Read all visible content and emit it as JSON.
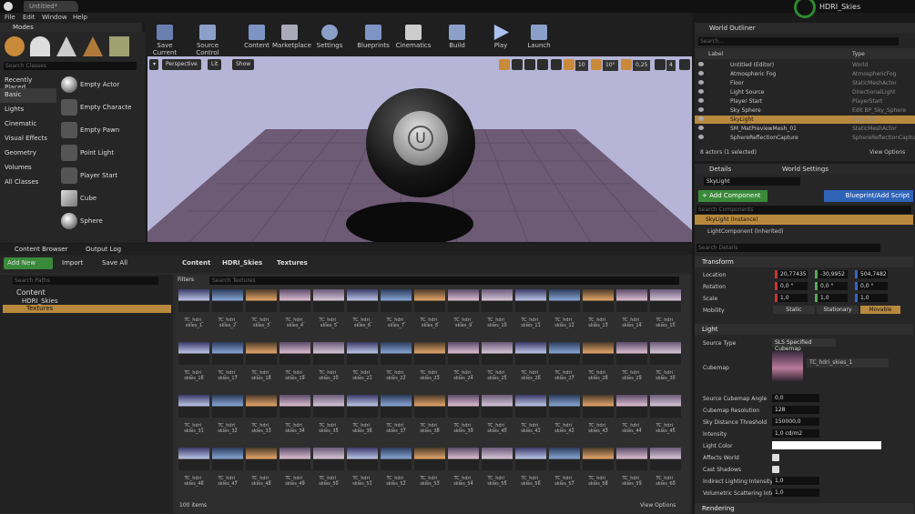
{
  "window": {
    "tab": "Untitled*",
    "project": "HDRI_Skies"
  },
  "menu": [
    "File",
    "Edit",
    "Window",
    "Help"
  ],
  "modes": {
    "tab": "Modes",
    "search_placeholder": "Search Classes",
    "categories": [
      "Recently Placed",
      "Basic",
      "Lights",
      "Cinematic",
      "Visual Effects",
      "Geometry",
      "Volumes",
      "All Classes"
    ],
    "actors": [
      "Empty Actor",
      "Empty Characte",
      "Empty Pawn",
      "Point Light",
      "Player Start",
      "Cube",
      "Sphere"
    ]
  },
  "toolbar": [
    "Save Current",
    "Source Control",
    "Content",
    "Marketplace",
    "Settings",
    "Blueprints",
    "Cinematics",
    "Build",
    "Play",
    "Launch"
  ],
  "viewport": {
    "perspective": "Perspective",
    "lit": "Lit",
    "show": "Show",
    "snap": "10",
    "rot": "10°",
    "scale": "0,25",
    "cams": "4"
  },
  "outliner": {
    "tab": "World Outliner",
    "search": "Search...",
    "col_label": "Label",
    "col_type": "Type",
    "rows": [
      [
        "Untitled (Editor)",
        "World"
      ],
      [
        "Atmospheric Fog",
        "AtmosphericFog"
      ],
      [
        "Floor",
        "StaticMeshActor"
      ],
      [
        "Light Source",
        "DirectionalLight"
      ],
      [
        "Player Start",
        "PlayerStart"
      ],
      [
        "Sky Sphere",
        "Edit BP_Sky_Sphere"
      ],
      [
        "SkyLight",
        "SkyLight"
      ],
      [
        "SM_MatPreviewMesh_01",
        "StaticMeshActor"
      ],
      [
        "SphereReflectionCapture",
        "SphereReflectionCapture"
      ]
    ],
    "status": "8 actors (1 selected)",
    "view_options": "View Options"
  },
  "details": {
    "tab1": "Details",
    "tab2": "World Settings",
    "name": "SkyLight",
    "add_comp": "+ Add Component",
    "bp": "Blueprint/Add Script",
    "search_comp": "Search Components",
    "inst": "SkyLight (Instance)",
    "comp": "LightComponent (Inherited)",
    "search_det": "Search Details",
    "transform": "Transform",
    "location": "Location",
    "rotation": "Rotation",
    "scale": "Scale",
    "mobility": "Mobility",
    "loc": [
      "20,77435",
      "-30,9952",
      "504,7482"
    ],
    "rot": [
      "0,0 °",
      "0,0 °",
      "0,0 °"
    ],
    "scl": [
      "1,0",
      "1,0",
      "1,0"
    ],
    "mob": [
      "Static",
      "Stationary",
      "Movable"
    ],
    "light": "Light",
    "source_type": "Source Type",
    "source_val": "SLS Specified Cubemap",
    "cubemap": "Cubemap",
    "cubemap_val": "TC_hdri_skies_1",
    "props": [
      [
        "Source Cubemap Angle",
        "0,0"
      ],
      [
        "Cubemap Resolution",
        "128"
      ],
      [
        "Sky Distance Threshold",
        "150000,0"
      ],
      [
        "Intensity",
        "1,0 cd/m2"
      ],
      [
        "Light Color",
        ""
      ],
      [
        "Affects World",
        ""
      ],
      [
        "Cast Shadows",
        ""
      ],
      [
        "Indirect Lighting Intensity",
        "1,0"
      ],
      [
        "Volumetric Scattering Inten",
        "1,0"
      ]
    ],
    "rendering": "Rendering"
  },
  "content": {
    "tab1": "Content Browser",
    "tab2": "Output Log",
    "add_new": "Add New",
    "import": "Import",
    "save_all": "Save All",
    "path": [
      "Content",
      "HDRI_Skies",
      "Textures"
    ],
    "search_paths": "Search Paths",
    "filters": "Filters",
    "search_tex": "Search Textures",
    "tree": [
      "Content",
      "HDRI_Skies",
      "Textures"
    ],
    "count": "100 items",
    "view_options": "View Options"
  }
}
